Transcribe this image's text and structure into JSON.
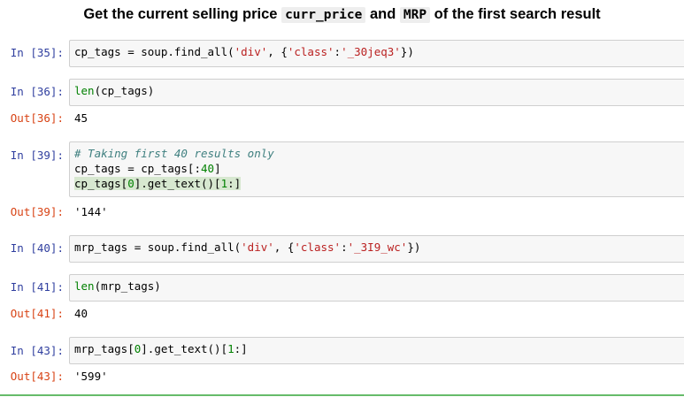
{
  "heading": {
    "prefix": "Get the current selling price ",
    "code1": "curr_price",
    "middle": " and ",
    "code2": "MRP",
    "suffix": " of the first search result"
  },
  "cells": [
    {
      "in_prompt": "In [35]:",
      "parts": [
        "cp_tags = soup.find_all(",
        "'div'",
        ", {",
        "'class'",
        ":",
        "'_30jeq3'",
        "})"
      ]
    },
    {
      "in_prompt": "In [36]:",
      "parts": [
        "len",
        "(cp_tags)"
      ],
      "out_prompt": "Out[36]:",
      "output": "45"
    },
    {
      "in_prompt": "In [39]:",
      "comment": "# Taking first 40 results only",
      "line2": [
        "cp_tags = cp_tags[:",
        "40",
        "]"
      ],
      "line3": [
        "cp_tags[",
        "0",
        "].get_text()[",
        "1",
        ":]"
      ],
      "out_prompt": "Out[39]:",
      "output": "'144'"
    },
    {
      "in_prompt": "In [40]:",
      "parts": [
        "mrp_tags = soup.find_all(",
        "'div'",
        ", {",
        "'class'",
        ":",
        "'_3I9_wc'",
        "})"
      ]
    },
    {
      "in_prompt": "In [41]:",
      "parts": [
        "len",
        "(mrp_tags)"
      ],
      "out_prompt": "Out[41]:",
      "output": "40"
    },
    {
      "in_prompt": "In [43]:",
      "parts": [
        "mrp_tags[",
        "0",
        "].get_text()[",
        "1",
        ":]"
      ],
      "out_prompt": "Out[43]:",
      "output": "'599'"
    }
  ]
}
